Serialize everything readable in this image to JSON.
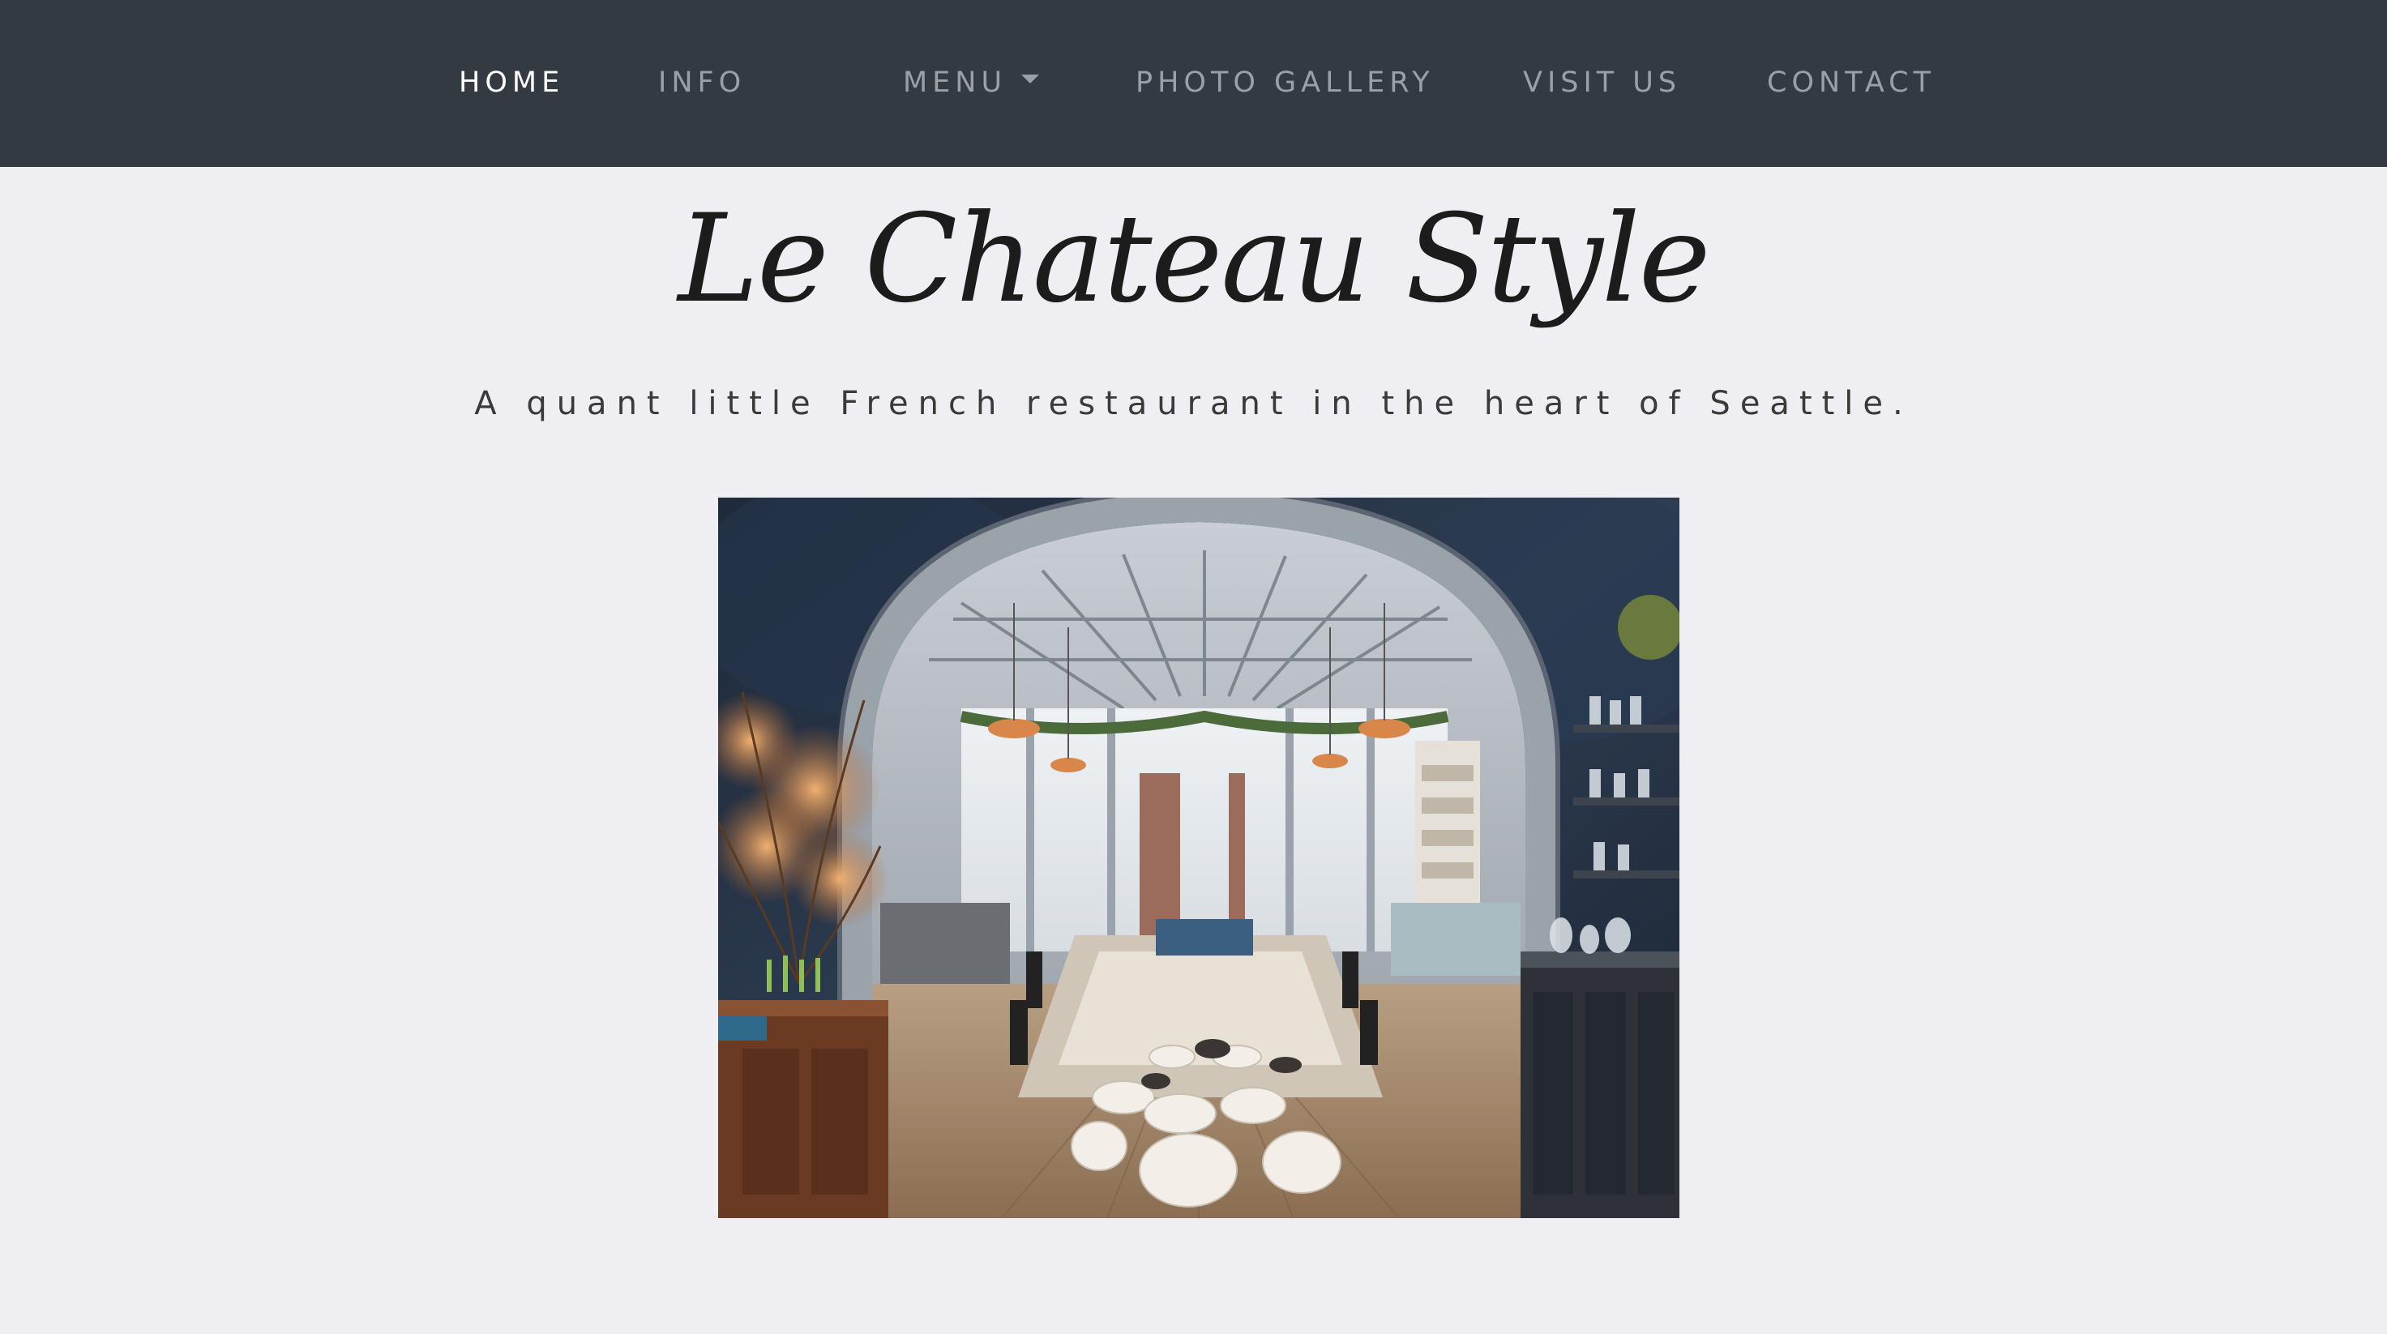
{
  "nav": {
    "items": [
      {
        "label": "HOME",
        "active": true
      },
      {
        "label": "INFO",
        "active": false
      },
      {
        "label": "MENU",
        "active": false,
        "dropdown": true
      },
      {
        "label": "PHOTO GALLERY",
        "active": false
      },
      {
        "label": "VISIT US",
        "active": false
      },
      {
        "label": "CONTACT",
        "active": false
      }
    ]
  },
  "brand": {
    "title": "Le Chateau Style",
    "tagline": "A quant little French restaurant in the heart of Seattle."
  },
  "colors": {
    "navbar": "#343a42",
    "page_background": "#efeff3",
    "nav_active": "#ffffff",
    "nav_inactive": "#9aa0a6"
  },
  "icons": {
    "menu_dropdown": "caret-down-icon"
  }
}
